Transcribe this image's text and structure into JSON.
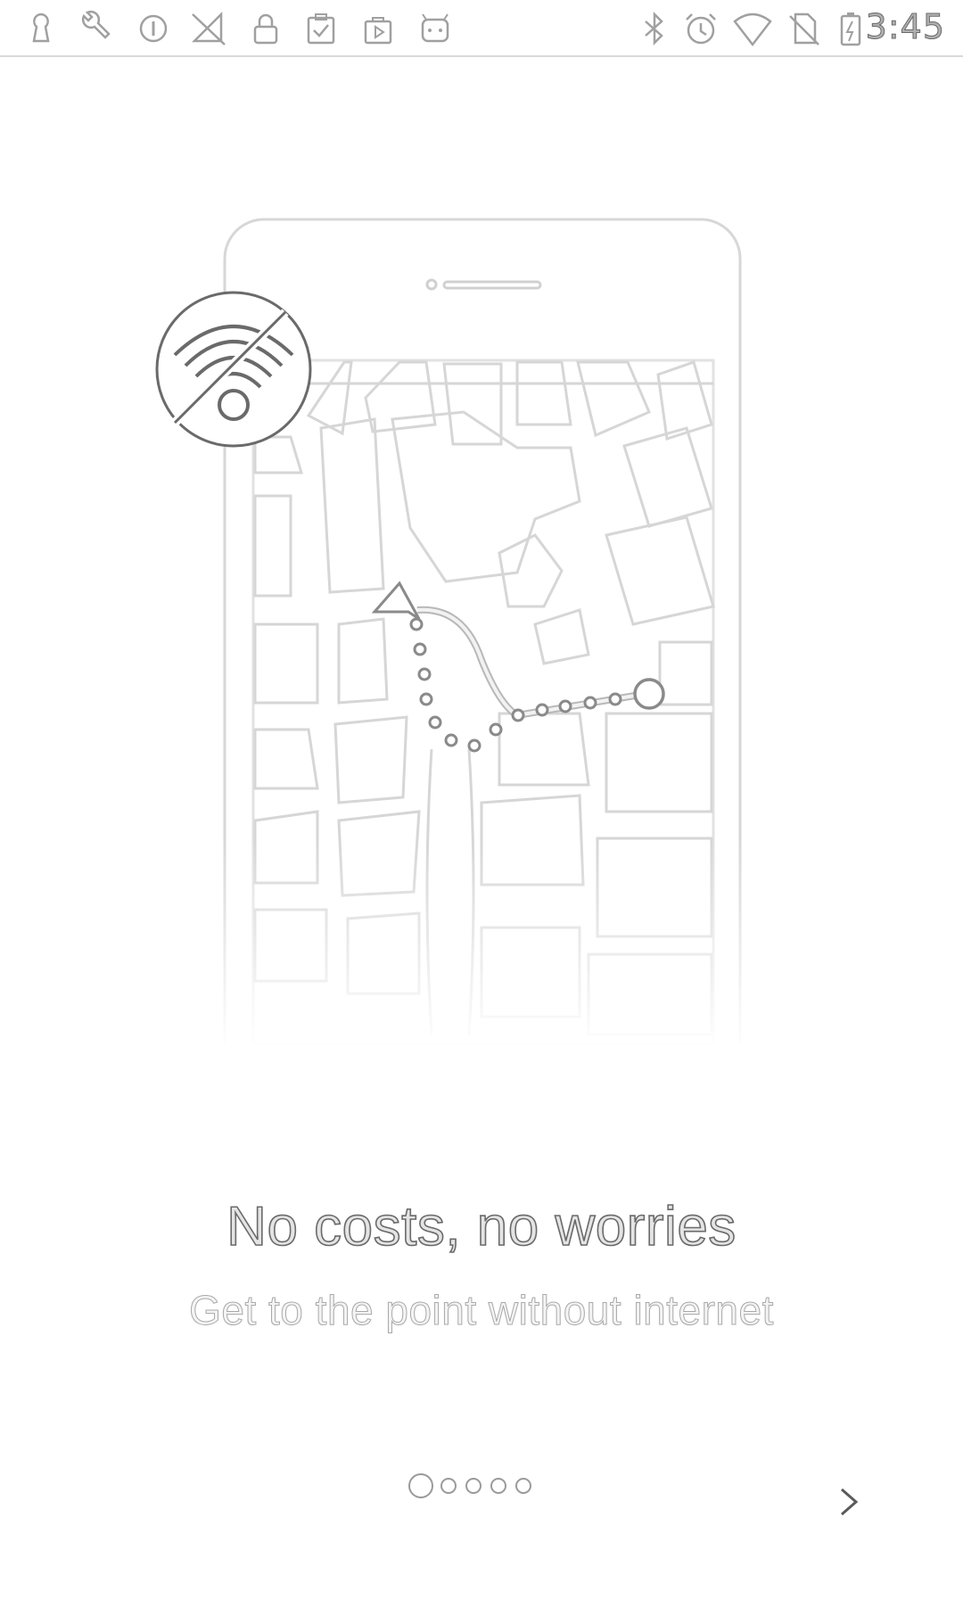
{
  "status_bar": {
    "time": "3:45",
    "left_icons": [
      "keyhole-icon",
      "wrench-icon",
      "circle-i-icon",
      "no-signal-icon",
      "lock-icon",
      "clipboard-check-icon",
      "play-bag-icon",
      "android-icon"
    ],
    "right_icons": [
      "bluetooth-icon",
      "alarm-icon",
      "wifi-icon",
      "no-sim-icon",
      "battery-charging-icon"
    ]
  },
  "onboarding": {
    "title": "No costs, no worries",
    "subtitle": "Get to the point without internet",
    "page_count": 5,
    "current_page": 1,
    "next_icon": "chevron-right-icon"
  },
  "colors": {
    "background": "#ffffff",
    "title_text": "#6a6a6a",
    "subtitle_text": "#a9a9a9",
    "illustration_line": "#cfcfcf"
  }
}
